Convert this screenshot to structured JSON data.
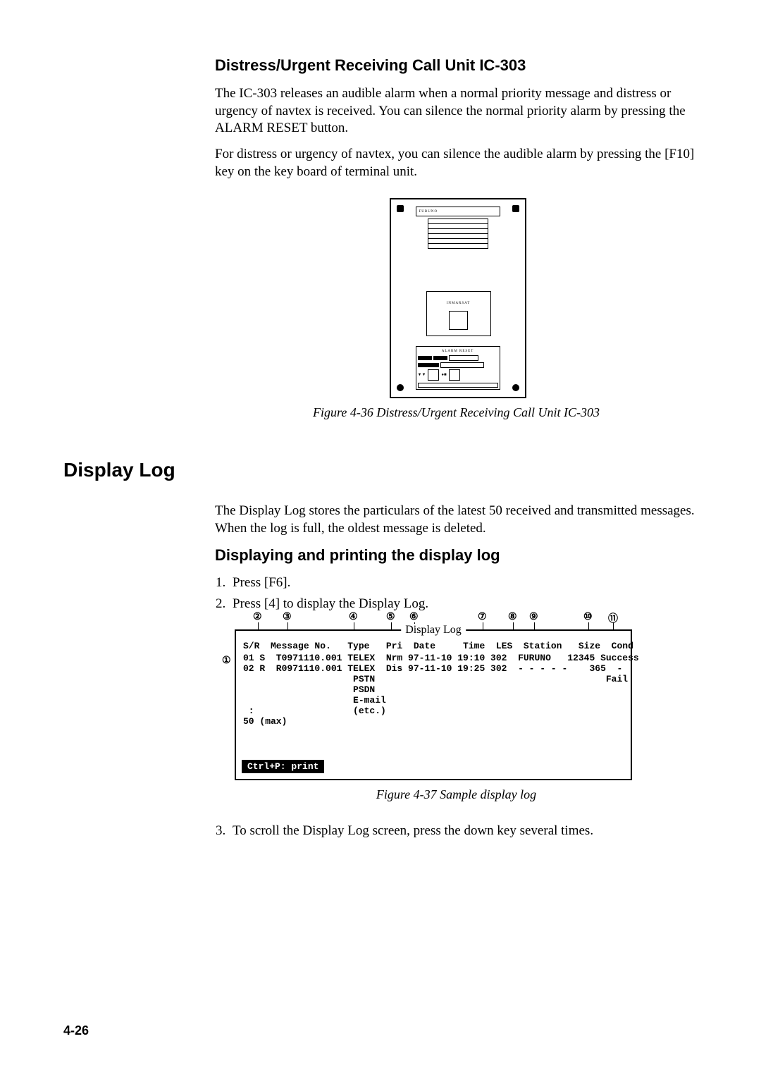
{
  "section1": {
    "heading": "Distress/Urgent Receiving Call Unit IC-303",
    "para1": "The IC-303 releases an audible alarm when a normal priority message and distress or urgency of navtex  is received. You can silence the normal priority  alarm by pressing the ALARM RESET button.",
    "para2": "For distress or urgency of navtex, you can silence the audible alarm by pressing the [F10] key on the key board of terminal unit.",
    "device_labels": {
      "top": "FURUNO",
      "mid": "INMARSAT",
      "bottom": "ALARM RESET"
    },
    "caption": "Figure 4-36 Distress/Urgent Receiving Call Unit IC-303"
  },
  "section2": {
    "heading": "Display Log",
    "para": "The Display Log stores the particulars of the latest 50 received and transmitted messages. When the log is full, the oldest message is deleted.",
    "sub_heading": "Displaying and printing the display log",
    "steps": {
      "1": "Press [F6].",
      "2": "Press [4] to display the Display Log.",
      "3": "To scroll the Display Log screen, press the down key several times."
    },
    "annotations": [
      "①",
      "②",
      "③",
      "④",
      "⑤",
      "⑥",
      "⑦",
      "⑧",
      "⑨",
      "⑩",
      "⑪"
    ],
    "log": {
      "title": "Display Log",
      "header": "S/R  Message No.   Type   Pri  Date     Time  LES  Station   Size  Cond",
      "rows": [
        "01 S  T0971110.001 TELEX  Nrm 97-11-10 19:10 302  FURUNO   12345 Success",
        "02 R  R0971110.001 TELEX  Dis 97-11-10 19:25 302  - - - - -    365  -",
        "                    PSTN                                          Fail",
        "                    PSDN",
        "                    E-mail",
        " :                  (etc.)",
        "50 (max)"
      ],
      "status": "Ctrl+P: print"
    },
    "caption": "Figure 4-37 Sample display log"
  },
  "page_number": "4-26"
}
